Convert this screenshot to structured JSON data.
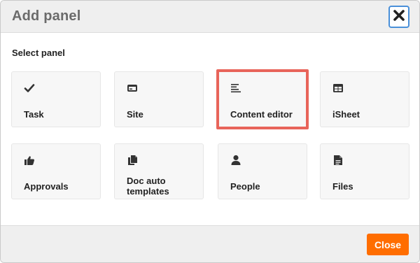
{
  "dialog": {
    "title": "Add panel",
    "close_icon": "close-x-icon"
  },
  "section": {
    "label": "Select panel"
  },
  "panels": [
    {
      "label": "Task",
      "icon": "checkmark-icon"
    },
    {
      "label": "Site",
      "icon": "browser-window-icon"
    },
    {
      "label": "Content editor",
      "icon": "text-align-left-icon",
      "highlighted": true
    },
    {
      "label": "iSheet",
      "icon": "table-icon"
    },
    {
      "label": "Approvals",
      "icon": "thumbs-up-icon"
    },
    {
      "label": "Doc auto templates",
      "icon": "copy-documents-icon"
    },
    {
      "label": "People",
      "icon": "person-icon"
    },
    {
      "label": "Files",
      "icon": "file-icon"
    }
  ],
  "footer": {
    "close_label": "Close"
  },
  "colors": {
    "accent": "#ff6d00",
    "highlight": "#e8645a",
    "focus": "#4a90d9"
  }
}
